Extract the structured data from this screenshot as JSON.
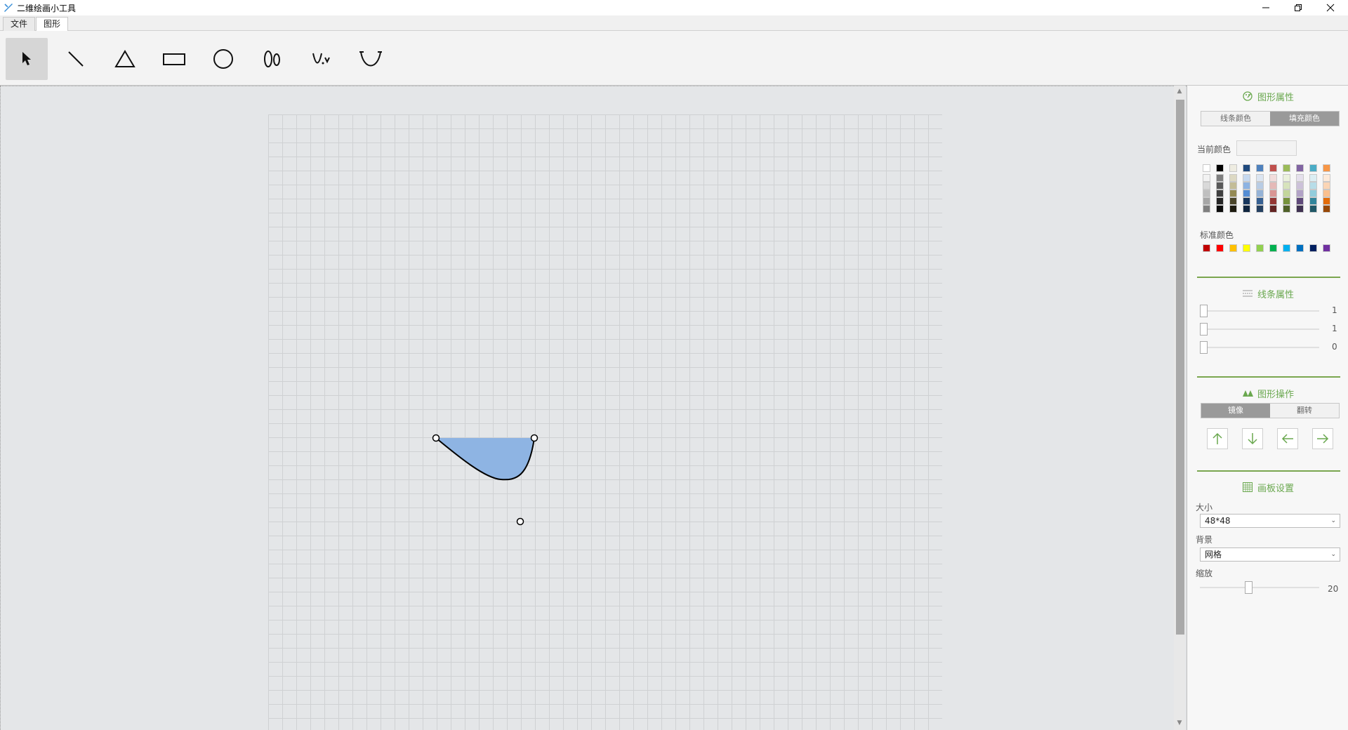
{
  "window": {
    "title": "二维绘画小工具"
  },
  "menu": {
    "tabs": [
      {
        "label": "文件"
      },
      {
        "label": "图形"
      }
    ]
  },
  "toolbar": {
    "tools": [
      {
        "name": "select-tool",
        "icon": "cursor-arrow-icon",
        "active": true
      },
      {
        "name": "line-tool",
        "icon": "line-icon"
      },
      {
        "name": "triangle-tool",
        "icon": "triangle-icon"
      },
      {
        "name": "rectangle-tool",
        "icon": "rectangle-icon"
      },
      {
        "name": "circle-tool",
        "icon": "circle-icon"
      },
      {
        "name": "ellipse-tool",
        "icon": "ellipse-icon"
      },
      {
        "name": "curve-tool",
        "icon": "curve-icon"
      },
      {
        "name": "arc-tool",
        "icon": "arc-icon"
      }
    ]
  },
  "panel": {
    "shape_props": {
      "title": "图形属性",
      "tabs": {
        "line": "线条颜色",
        "fill": "填充颜色"
      },
      "current_color_label": "当前颜色",
      "standard_colors_label": "标准颜色",
      "theme_colors": [
        [
          "#ffffff",
          "#f2f2f2",
          "#d9d9d9",
          "#bfbfbf",
          "#a6a6a6",
          "#808080"
        ],
        [
          "#000000",
          "#7f7f7f",
          "#595959",
          "#404040",
          "#262626",
          "#0d0d0d"
        ],
        [
          "#eeece1",
          "#ddd9c3",
          "#c4bd97",
          "#948a54",
          "#4a452a",
          "#1d1b10"
        ],
        [
          "#1f497d",
          "#c6d9f0",
          "#8db3e2",
          "#548dd4",
          "#17365d",
          "#0f243e"
        ],
        [
          "#4f81bd",
          "#dbe5f1",
          "#b8cce4",
          "#95b3d7",
          "#366092",
          "#244061"
        ],
        [
          "#c0504d",
          "#f2dcdb",
          "#e5b9b7",
          "#d99694",
          "#953734",
          "#632423"
        ],
        [
          "#9bbb59",
          "#ebf1dd",
          "#d7e3bc",
          "#c3d69b",
          "#76923c",
          "#4f6128"
        ],
        [
          "#8064a2",
          "#e5e0ec",
          "#ccc1d9",
          "#b2a2c7",
          "#5f497a",
          "#3f3151"
        ],
        [
          "#4bacc6",
          "#dbeef3",
          "#b7dde8",
          "#92cddc",
          "#31859b",
          "#205867"
        ],
        [
          "#f79646",
          "#fdeada",
          "#fbd5b5",
          "#fac08f",
          "#e36c09",
          "#974806"
        ]
      ],
      "standard_colors": [
        "#c00000",
        "#ff0000",
        "#ffc000",
        "#ffff00",
        "#92d050",
        "#00b050",
        "#00b0f0",
        "#0070c0",
        "#002060",
        "#7030a0"
      ]
    },
    "line_props": {
      "title": "线条属性",
      "sliders": [
        {
          "value": "1",
          "level": 0
        },
        {
          "value": "1",
          "level": 0
        },
        {
          "value": "0",
          "level": 0
        }
      ]
    },
    "shape_ops": {
      "title": "图形操作",
      "tabs": {
        "mirror": "镜像",
        "flip": "翻转"
      }
    },
    "board": {
      "title": "画板设置",
      "size_label": "大小",
      "size_value": "48*48",
      "bg_label": "背景",
      "bg_value": "网格",
      "zoom_label": "缩放",
      "zoom_value": "20",
      "zoom_level": 0.4
    }
  },
  "colors": {
    "accent": "#6aa84f",
    "shape_fill": "#8eb4e3",
    "canvas_bg": "#e4e6e8"
  }
}
